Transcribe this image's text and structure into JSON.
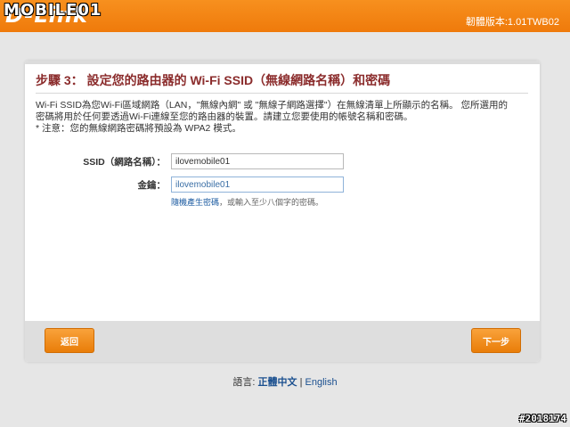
{
  "header": {
    "brand_logo": "D-Link",
    "watermark": "MOBILE01",
    "firmware_label": "韌體版本:1.01TWB02",
    "accent_color": "#f7901e"
  },
  "wizard": {
    "title": "步驟 3： 設定您的路由器的 Wi-Fi SSID（無線網路名稱）和密碼",
    "desc_line1": "Wi-Fi SSID為您Wi-Fi區域網路（LAN，\"無線內網\" 或 \"無線子網路選擇\"）在無線清單上所顯示的名稱。 您所選用的",
    "desc_line2": "密碼將用於任何要透過Wi-Fi連線至您的路由器的裝置。請建立您要使用的帳號名稱和密碼。",
    "desc_note": "* 注意：您的無線網路密碼將預設為 WPA2 模式。",
    "ssid_label": "SSID（網路名稱）：",
    "ssid_value": "ilovemobile01",
    "key_label": "金鑰：",
    "key_value": "ilovemobile01",
    "hint_link": "隨機產生密碼",
    "hint_text": "，或輸入至少八個字的密碼。",
    "back_label": "返回",
    "next_label": "下一步"
  },
  "footer": {
    "lang_prefix": "語言:",
    "lang_current": "正體中文",
    "lang_sep": "|",
    "lang_other": "English",
    "stamp": "#2018174"
  }
}
